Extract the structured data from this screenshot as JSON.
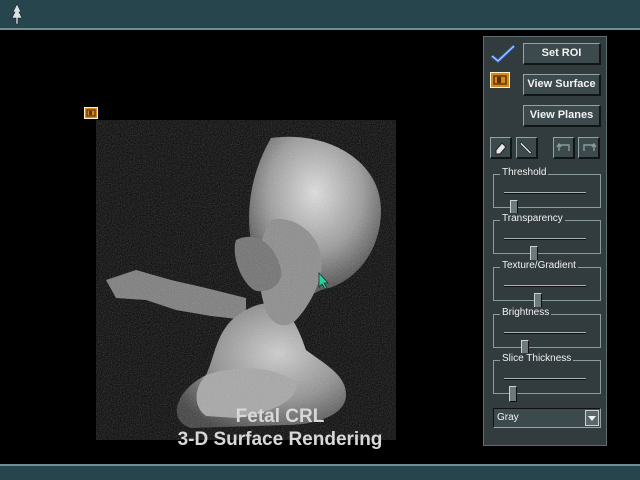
{
  "caption": {
    "line1": "Fetal CRL",
    "line2": "3-D Surface Rendering"
  },
  "panel": {
    "set_roi": "Set ROI",
    "view_surface": "View Surface",
    "view_planes": "View Planes",
    "icons": [
      "checkmark-icon",
      "roi-box-icon",
      "eraser-icon",
      "scalpel-icon",
      "undo-icon",
      "redo-icon"
    ]
  },
  "sliders": [
    {
      "label": "Threshold",
      "value": 0.12
    },
    {
      "label": "Transparency",
      "value": 0.36
    },
    {
      "label": "Texture/Gradient",
      "value": 0.42
    },
    {
      "label": "Brightness",
      "value": 0.25
    },
    {
      "label": "Slice Thickness",
      "value": 0.11
    }
  ],
  "colormap": {
    "selected": "Gray"
  },
  "colors": {
    "bar": "#26454c",
    "panel": "#323c3e",
    "button": "#3d4a4d",
    "accent_check": "#3b6fd8",
    "accent_roi": "#d68a1c",
    "cursor": "#2fd0a0"
  }
}
